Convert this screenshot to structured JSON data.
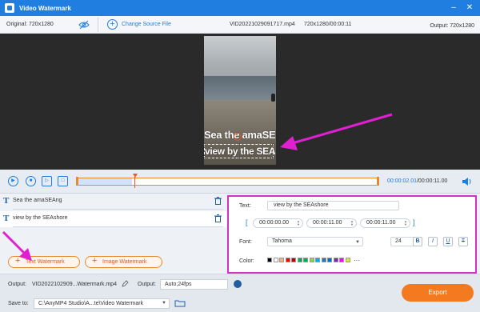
{
  "window": {
    "title": "Video Watermark"
  },
  "infobar": {
    "original": "Original: 720x1280",
    "change_source": "Change Source File",
    "filename": "VID20221029091717.mp4",
    "file_info": "720x1280/00:00:11",
    "output": "Output: 720x1280"
  },
  "preview": {
    "watermark_1": "Sea the amaSEAng",
    "watermark_2": "view by the SEAshore"
  },
  "timeline": {
    "current": "00:00:02.01",
    "total": "/00:00:11.00",
    "progress": 0.18
  },
  "watermarks": [
    {
      "label": "Sea the amaSEAng"
    },
    {
      "label": "view by the SEAshore"
    }
  ],
  "buttons": {
    "text_watermark": "Text Watermark",
    "image_watermark": "Image Watermark",
    "export": "Export"
  },
  "settings": {
    "text_label": "Text:",
    "text_value": "view by the SEAshore",
    "start_time": "00:00:00.00",
    "duration": "00:00:11.00",
    "end_time": "00:00:11.00",
    "font_label": "Font:",
    "font_value": "Tahoma",
    "size_value": "24",
    "color_label": "Color:",
    "bold": "B",
    "italic": "I",
    "underline": "U",
    "strike": "T",
    "more": "···"
  },
  "colors": [
    "#000000",
    "#ffffff",
    "#f4b183",
    "#ff0000",
    "#c00000",
    "#00b050",
    "#00b050",
    "#92d050",
    "#00b0f0",
    "#2e75b6",
    "#0070c0",
    "#7030a0",
    "#ff00ff",
    "#d9ea32"
  ],
  "bottom": {
    "output_label": "Output:",
    "output_file": "VID2022102909...Watermark.mp4",
    "output2_label": "Output:",
    "output_format": "Auto;24fps",
    "save_label": "Save to:",
    "save_path": "C:\\AnyMP4 Studio\\A...te\\Video Watermark"
  },
  "accent": "#1f7ee0",
  "annotation_color": "#e020d0"
}
